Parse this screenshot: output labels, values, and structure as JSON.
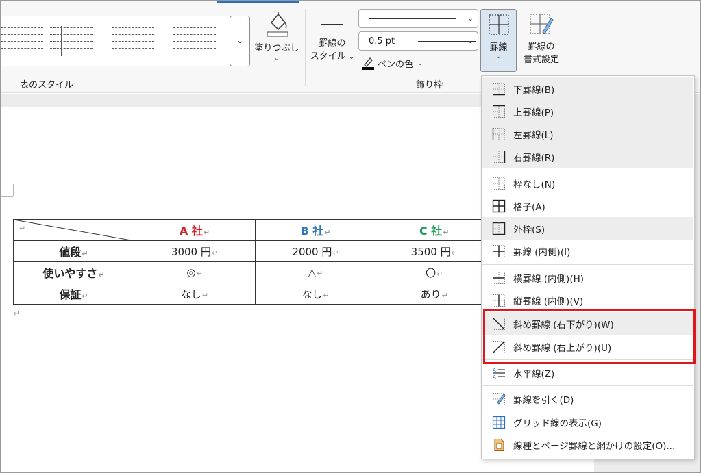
{
  "ribbon": {
    "table_styles_group_label": "表のスタイル",
    "shading_label": "塗りつぶし",
    "border_style_label_1": "罫線の",
    "border_style_label_2": "スタイル",
    "line_weight_value": "0.5 pt",
    "pen_color_label": "ペンの色",
    "borders_group_label": "飾り枠",
    "borders_label": "罫線",
    "border_painter_label_1": "罫線の",
    "border_painter_label_2": "書式設定"
  },
  "table": {
    "headers": [
      "A 社",
      "B 社",
      "C 社"
    ],
    "header_colors": [
      "#d3202a",
      "#2e75b6",
      "#1e9a5a"
    ],
    "rows": [
      {
        "label": "値段",
        "values": [
          "3000 円",
          "2000 円",
          "3500 円"
        ]
      },
      {
        "label": "使いやすさ",
        "values": [
          "◎",
          "△",
          "〇"
        ]
      },
      {
        "label": "保証",
        "values": [
          "なし",
          "なし",
          "あり"
        ]
      }
    ]
  },
  "borders_menu": {
    "items": [
      {
        "icon": "bottom-border-icon",
        "label": "下罫線(B)"
      },
      {
        "icon": "top-border-icon",
        "label": "上罫線(P)"
      },
      {
        "icon": "left-border-icon",
        "label": "左罫線(L)"
      },
      {
        "icon": "right-border-icon",
        "label": "右罫線(R)"
      },
      {
        "icon": "no-border-icon",
        "label": "枠なし(N)"
      },
      {
        "icon": "all-borders-icon",
        "label": "格子(A)"
      },
      {
        "icon": "outside-borders-icon",
        "label": "外枠(S)"
      },
      {
        "icon": "inside-borders-icon",
        "label": "罫線 (内側)(I)"
      },
      {
        "icon": "inside-horizontal-border-icon",
        "label": "横罫線 (内側)(H)"
      },
      {
        "icon": "inside-vertical-border-icon",
        "label": "縦罫線 (内側)(V)"
      },
      {
        "icon": "diagonal-down-border-icon",
        "label": "斜め罫線 (右下がり)(W)"
      },
      {
        "icon": "diagonal-up-border-icon",
        "label": "斜め罫線 (右上がり)(U)"
      },
      {
        "icon": "horizontal-line-icon",
        "label": "水平線(Z)"
      },
      {
        "icon": "draw-table-icon",
        "label": "罫線を引く(D)"
      },
      {
        "icon": "view-gridlines-icon",
        "label": "グリッド線の表示(G)"
      },
      {
        "icon": "borders-and-shading-icon",
        "label": "線種とページ罫線と網かけの設定(O)..."
      }
    ]
  },
  "colors": {
    "highlight_box": "#e0161d",
    "borders_button_bg": "#dbe6f3"
  }
}
